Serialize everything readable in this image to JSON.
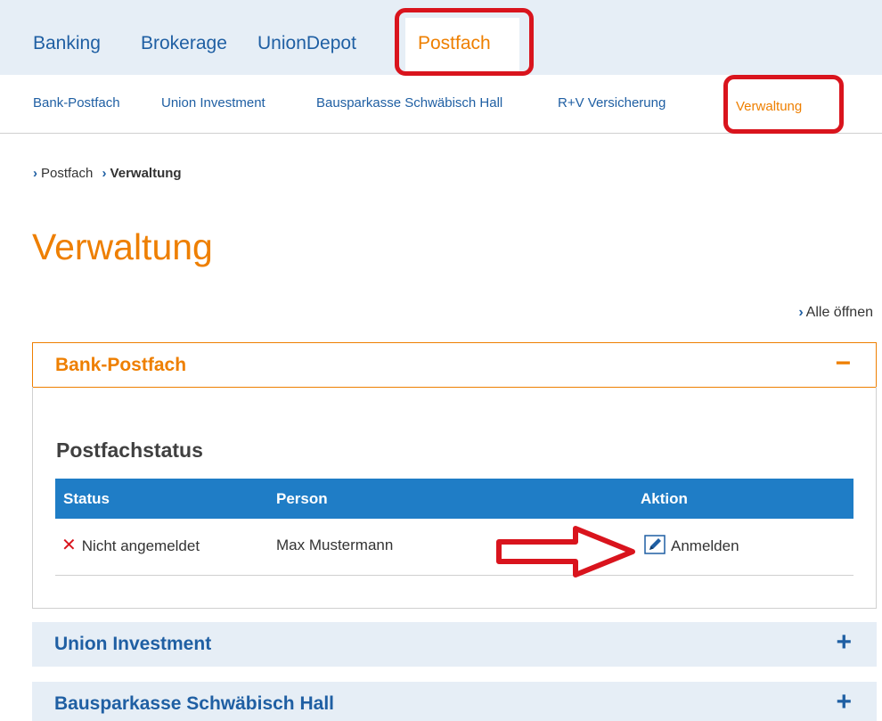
{
  "topnav": {
    "items": [
      {
        "label": "Banking",
        "active": false
      },
      {
        "label": "Brokerage",
        "active": false
      },
      {
        "label": "UnionDepot",
        "active": false
      },
      {
        "label": "Postfach",
        "active": true
      }
    ]
  },
  "subnav": {
    "items": [
      {
        "label": "Bank-Postfach"
      },
      {
        "label": "Union Investment"
      },
      {
        "label": "Bausparkasse Schwäbisch Hall"
      },
      {
        "label": "R+V Versicherung"
      },
      {
        "label": "Verwaltung",
        "active": true
      }
    ]
  },
  "breadcrumb": [
    "Postfach",
    "Verwaltung"
  ],
  "page_title": "Verwaltung",
  "open_all_label": "Alle öffnen",
  "accordion": [
    {
      "title": "Bank-Postfach",
      "expanded": true,
      "toggle": "−"
    },
    {
      "title": "Union Investment",
      "expanded": false,
      "toggle": "+"
    },
    {
      "title": "Bausparkasse Schwäbisch Hall",
      "expanded": false,
      "toggle": "+"
    }
  ],
  "postfachstatus": {
    "title": "Postfachstatus",
    "columns": [
      "Status",
      "Person",
      "Aktion"
    ],
    "rows": [
      {
        "status": "Nicht angemeldet",
        "person": "Max Mustermann",
        "action": "Anmelden"
      }
    ]
  },
  "colors": {
    "accent_orange": "#ee7f00",
    "link_blue": "#1f5fa3",
    "table_header_blue": "#1f7dc6",
    "annotation_red": "#d9141d",
    "nav_background": "#e6eef6"
  }
}
